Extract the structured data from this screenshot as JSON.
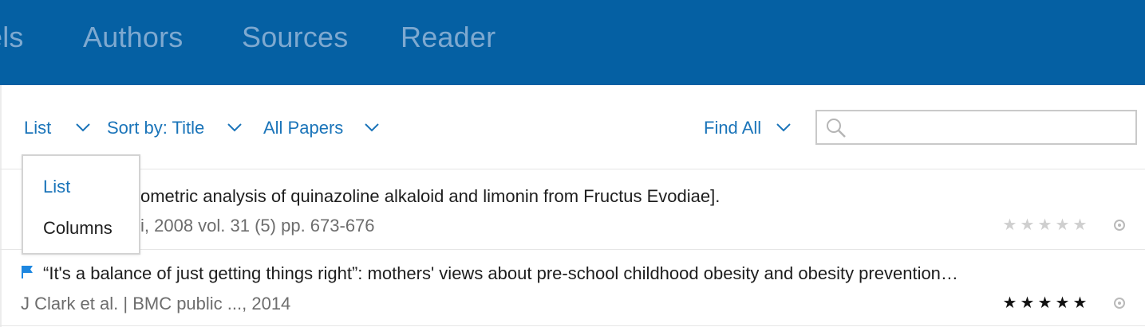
{
  "nav": {
    "partial_tab": "els",
    "tabs": [
      "Authors",
      "Sources",
      "Reader"
    ]
  },
  "toolbar": {
    "view_label": "List",
    "sort_label": "Sort by: Title",
    "filter_label": "All Papers",
    "find_label": "Find All",
    "search_placeholder": ""
  },
  "view_menu": {
    "options": [
      "List",
      "Columns"
    ],
    "selected": "List"
  },
  "papers": [
    {
      "title": "[Densitometric analysis of quinazoline alkaloid and limonin from Fructus Evodiae].",
      "visible_title": "ometric analysis of quinazoline alkaloid and limonin from Fructus Evodiae].",
      "meta_visible": "i, 2008 vol. 31 (5) pp. 673-676",
      "rating": 0,
      "flagged": false
    },
    {
      "title": "“It's a balance of just getting things right”: mothers' views about pre-school childhood obesity and obesity prevention…",
      "meta": "J Clark et al. | BMC public  ..., 2014",
      "rating": 5,
      "flagged": true
    }
  ],
  "colors": {
    "header_bg": "#0560a3",
    "accent": "#1a74b9",
    "flag": "#1d87e0"
  },
  "icons": {
    "search": "search-icon",
    "chevron": "chevron-down-icon",
    "flag": "flag-icon",
    "read_status": "read-status-icon",
    "star": "star-icon"
  }
}
